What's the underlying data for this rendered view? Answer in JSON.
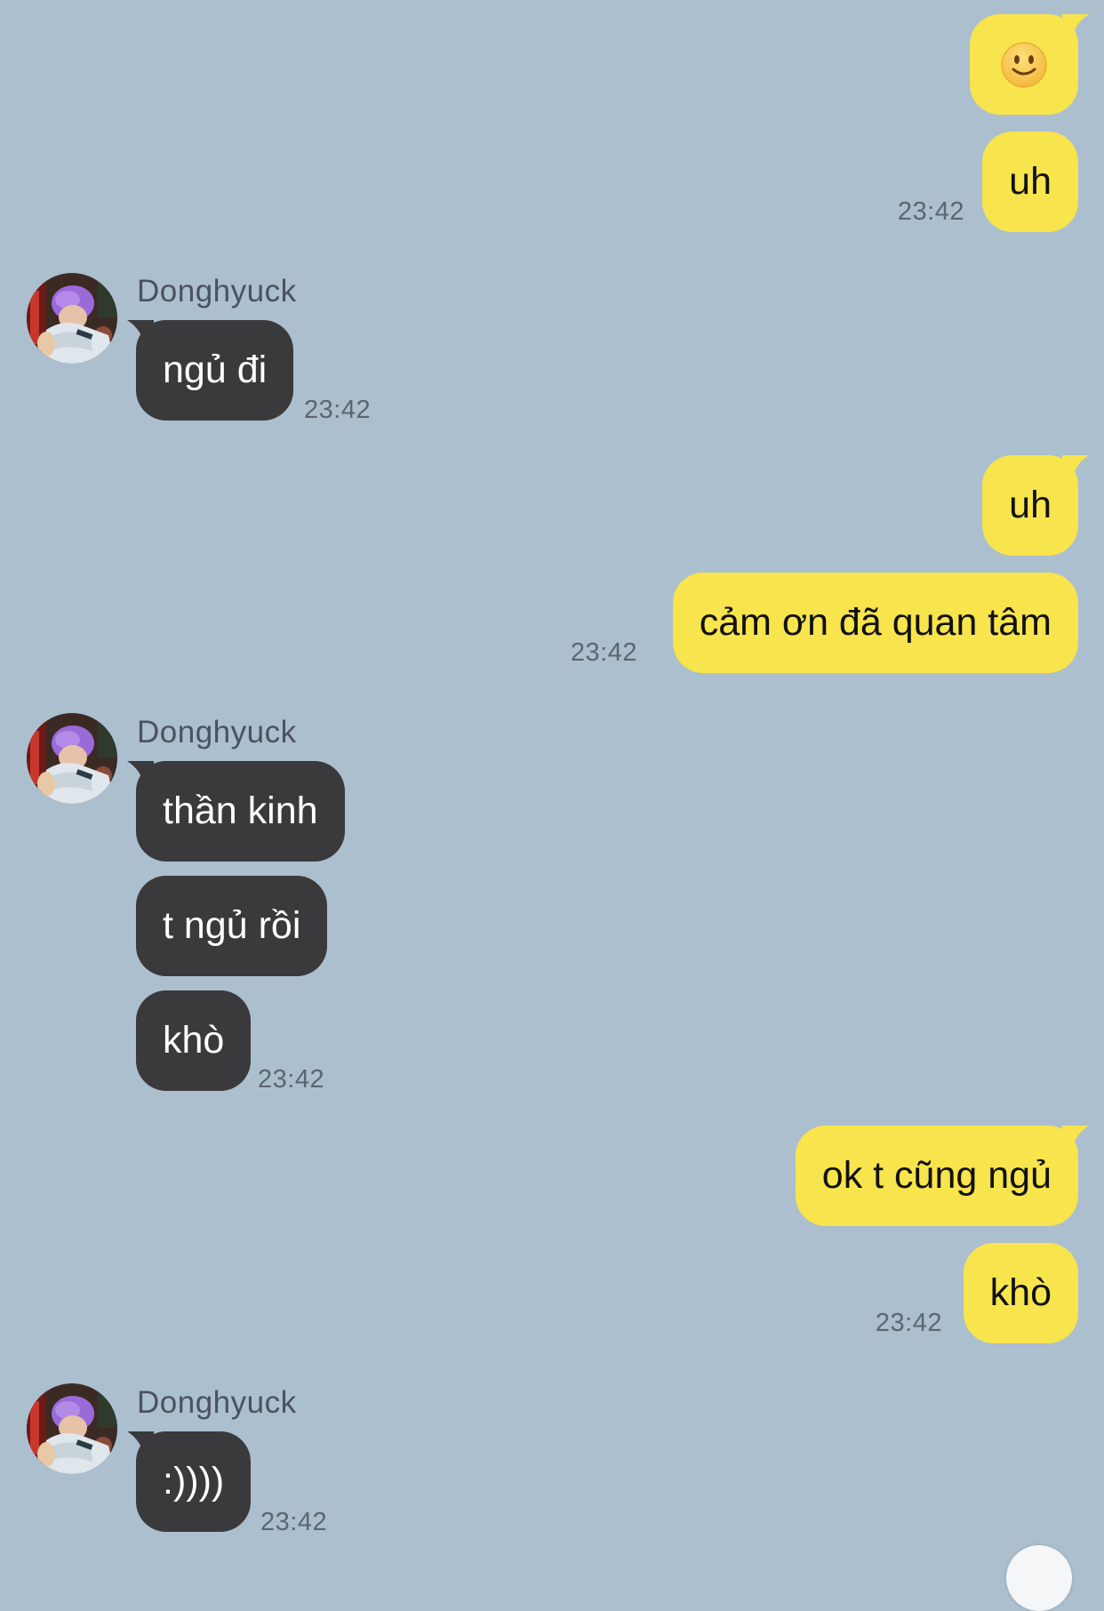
{
  "contact": {
    "name": "Donghyuck"
  },
  "messages": [
    {
      "from": "me",
      "text": "🙂",
      "emoji": "slightly-smiling-face"
    },
    {
      "from": "me",
      "text": "uh",
      "time": "23:42"
    },
    {
      "from": "them",
      "sender": "Donghyuck",
      "text": "ngủ đi",
      "time": "23:42"
    },
    {
      "from": "me",
      "text": "uh"
    },
    {
      "from": "me",
      "text": "cảm ơn đã quan tâm",
      "time": "23:42"
    },
    {
      "from": "them",
      "sender": "Donghyuck",
      "text": "thần kinh"
    },
    {
      "from": "them",
      "text": "t ngủ rồi"
    },
    {
      "from": "them",
      "text": "khò",
      "time": "23:42"
    },
    {
      "from": "me",
      "text": "ok t cũng ngủ"
    },
    {
      "from": "me",
      "text": "khò",
      "time": "23:42"
    },
    {
      "from": "them",
      "sender": "Donghyuck",
      "text": ":))))",
      "time": "23:42"
    }
  ],
  "colors": {
    "background": "#acbfcf",
    "my_bubble": "#f8e44c",
    "their_bubble": "#3a3a3c",
    "timestamp": "#5c6670"
  },
  "icons": {
    "scroll_down": "scroll-down-icon",
    "avatar": "contact-avatar"
  }
}
